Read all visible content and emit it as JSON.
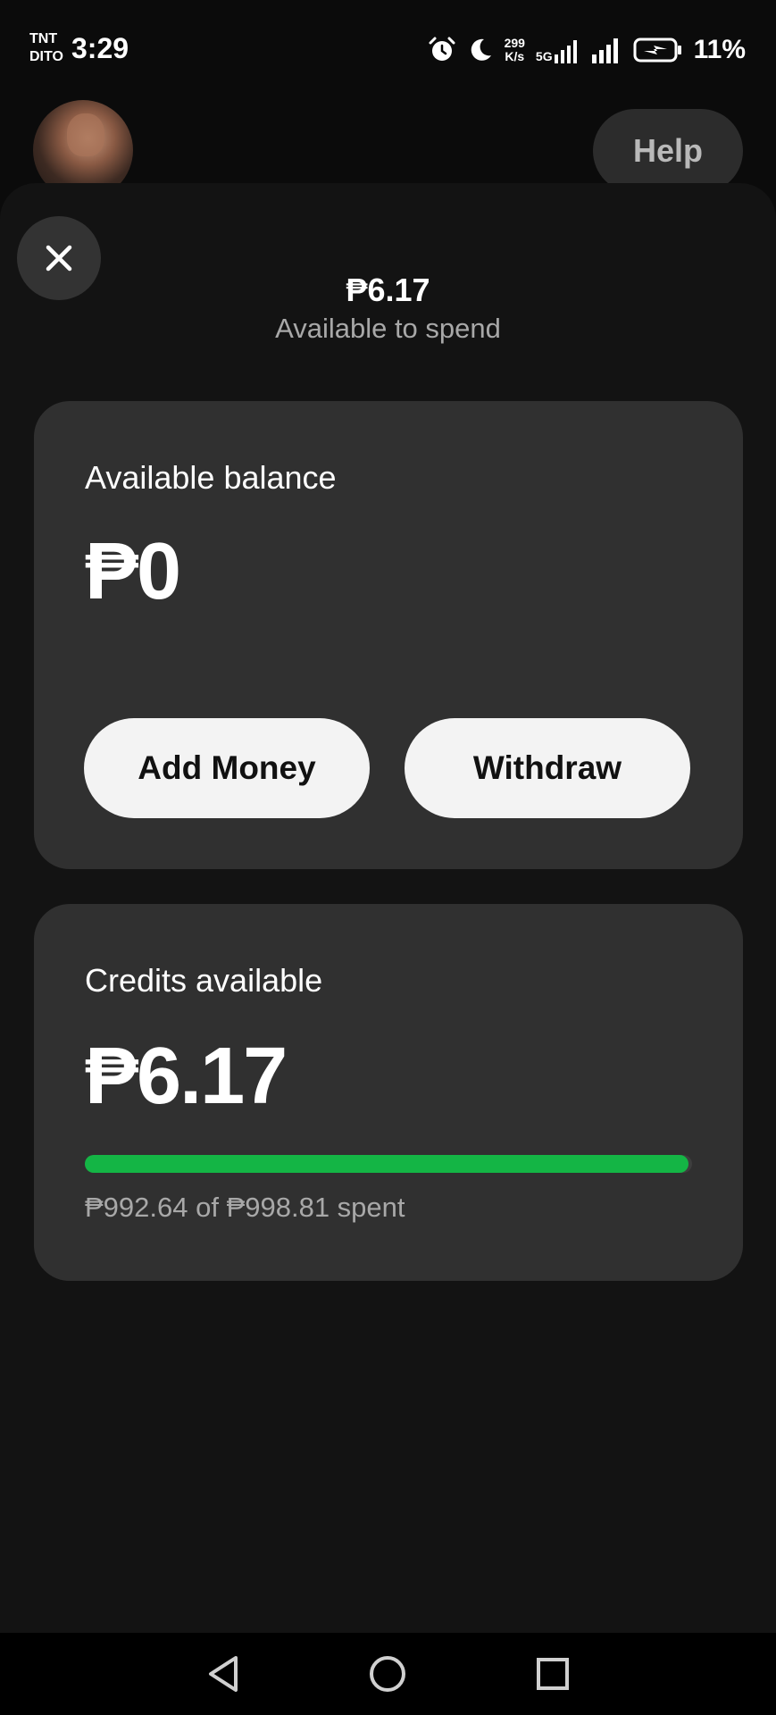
{
  "status_bar": {
    "carrier_line1": "TNT",
    "carrier_line2": "DITO",
    "time": "3:29",
    "net_speed_value": "299",
    "net_speed_unit": "K/s",
    "network_type": "5G",
    "battery_percent": "11%",
    "icons": [
      "alarm-icon",
      "moon-icon",
      "signal-icon",
      "signal-icon",
      "battery-charging-icon"
    ]
  },
  "header": {
    "help_label": "Help"
  },
  "summary": {
    "amount": "₱6.17",
    "label": "Available to spend"
  },
  "balance_card": {
    "title": "Available balance",
    "amount": "₱0",
    "add_money_label": "Add Money",
    "withdraw_label": "Withdraw"
  },
  "credits_card": {
    "title": "Credits available",
    "amount": "₱6.17",
    "spent_text": "₱992.64 of ₱998.81 spent",
    "progress_fraction": 0.9938,
    "progress_color": "#14b545"
  },
  "colors": {
    "background": "#0b0b0b",
    "sheet": "#131313",
    "card": "#303030",
    "button": "#f3f3f3",
    "muted_text": "#a8a8a8"
  }
}
